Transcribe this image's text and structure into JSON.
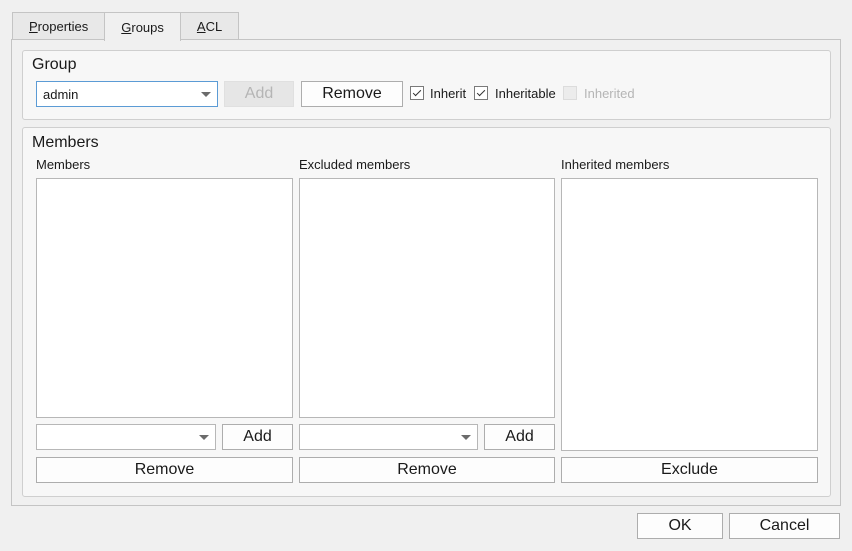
{
  "tabs": [
    {
      "label_mnemonic": "P",
      "label_rest": "roperties"
    },
    {
      "label_mnemonic": "G",
      "label_rest": "roups"
    },
    {
      "label_mnemonic": "A",
      "label_rest": "CL"
    }
  ],
  "group": {
    "title": "Group",
    "selected": "admin",
    "add_label": "Add",
    "remove_label": "Remove",
    "inherit_label": "Inherit",
    "inherit_checked": true,
    "inheritable_label": "Inheritable",
    "inheritable_checked": true,
    "inherited_label": "Inherited",
    "inherited_checked": false
  },
  "members_section": {
    "title": "Members",
    "members": {
      "label": "Members",
      "add_label": "Add",
      "remove_label": "Remove",
      "selected": ""
    },
    "excluded": {
      "label": "Excluded members",
      "add_label": "Add",
      "remove_label": "Remove",
      "selected": ""
    },
    "inherited": {
      "label": "Inherited members",
      "exclude_label": "Exclude"
    }
  },
  "footer": {
    "ok_label": "OK",
    "cancel_label": "Cancel"
  }
}
